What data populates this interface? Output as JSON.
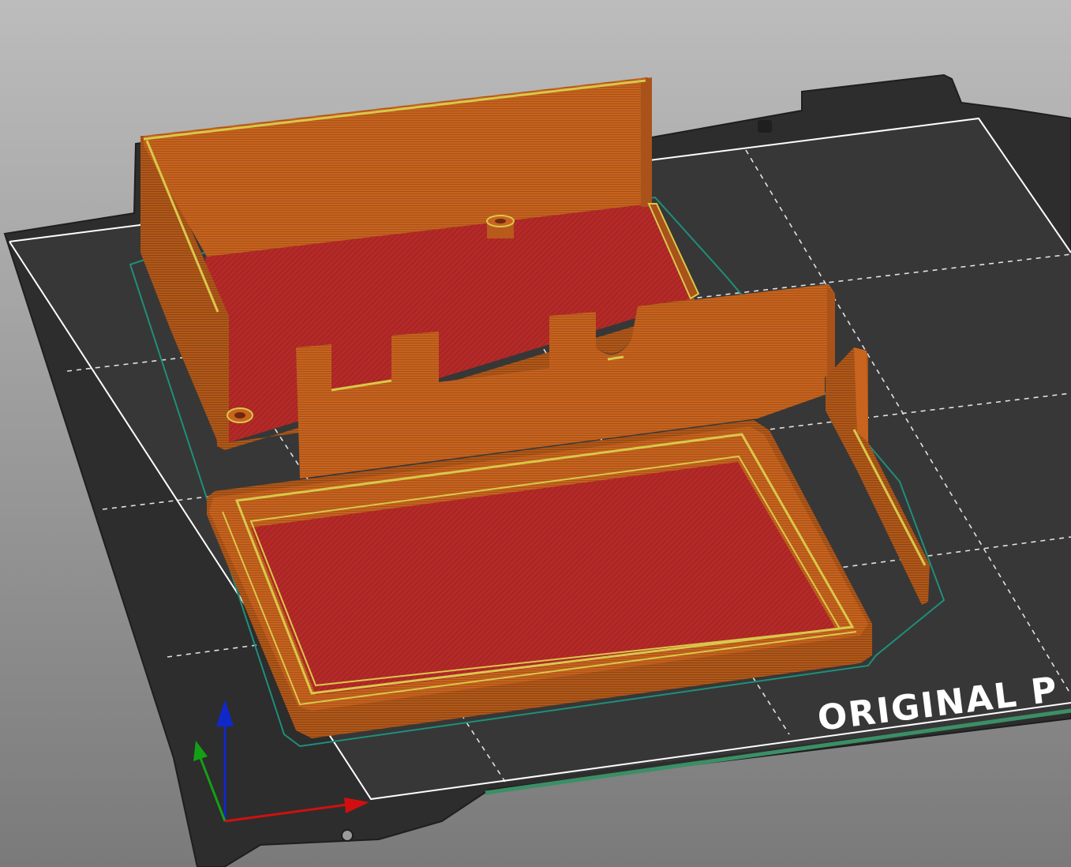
{
  "viewport": {
    "background_top": "#b9b9b9",
    "background_bottom": "#7d7d7d"
  },
  "bed": {
    "logo_text": "ORIGINAL P",
    "plate_color": "#2f2f2f",
    "print_area_color": "#3a3a3a",
    "grid_color": "#ffffff"
  },
  "objects": {
    "wall_color": "#c8641e",
    "fill_color": "#b8282a",
    "perimeter_color": "#d9c84a",
    "skirt_color": "#1f8f7a"
  },
  "axes": {
    "x_color": "#d01010",
    "y_color": "#14a014",
    "z_color": "#1028c8"
  }
}
